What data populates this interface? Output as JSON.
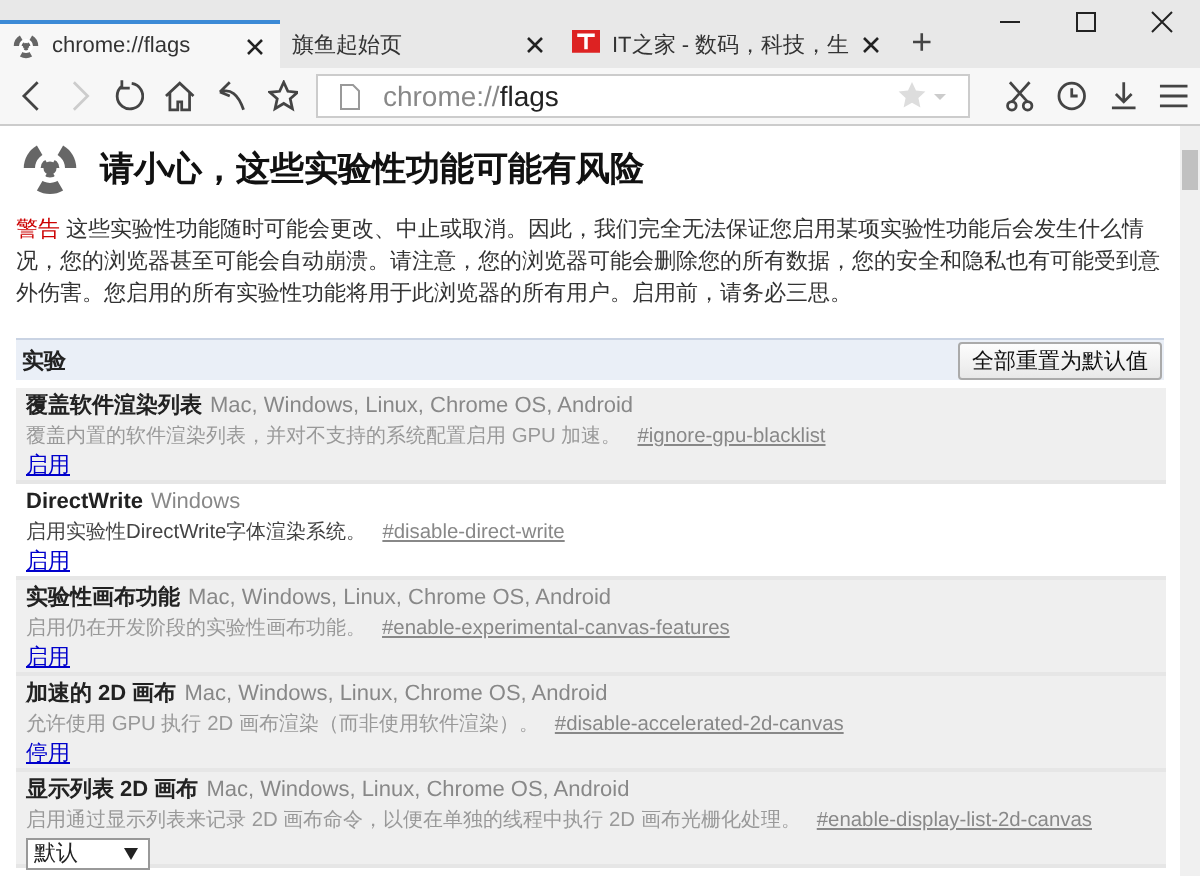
{
  "tabs": [
    {
      "title": "chrome://flags",
      "selected": true
    },
    {
      "title": "旗鱼起始页",
      "selected": false
    },
    {
      "title": "IT之家 - 数码，科技，生",
      "selected": false
    }
  ],
  "new_tab": "+",
  "address_bar": {
    "url_scheme": "chrome://",
    "url_path": "flags"
  },
  "page": {
    "heading": "请小心，这些实验性功能可能有风险",
    "warning_label": "警告",
    "warning_text": "这些实验性功能随时可能会更改、中止或取消。因此，我们完全无法保证您启用某项实验性功能后会发生什么情况，您的浏览器甚至可能会自动崩溃。请注意，您的浏览器可能会删除您的所有数据，您的安全和隐私也有可能受到意外伤害。您启用的所有实验性功能将用于此浏览器的所有用户。启用前，请务必三思。",
    "section_title": "实验",
    "reset_button": "全部重置为默认值"
  },
  "experiments": [
    {
      "name": "覆盖软件渲染列表",
      "platforms": "Mac, Windows, Linux, Chrome OS, Android",
      "description": "覆盖内置的软件渲染列表，并对不支持的系统配置启用 GPU 加速。",
      "anchor": "#ignore-gpu-blacklist",
      "dimmed": true,
      "action": {
        "kind": "link",
        "label": "启用"
      }
    },
    {
      "name": "DirectWrite",
      "platforms": "Windows",
      "description": "启用实验性DirectWrite字体渲染系统。",
      "anchor": "#disable-direct-write",
      "dimmed": false,
      "action": {
        "kind": "link",
        "label": "启用"
      }
    },
    {
      "name": "实验性画布功能",
      "platforms": "Mac, Windows, Linux, Chrome OS, Android",
      "description": "启用仍在开发阶段的实验性画布功能。",
      "anchor": "#enable-experimental-canvas-features",
      "dimmed": true,
      "action": {
        "kind": "link",
        "label": "启用"
      }
    },
    {
      "name": "加速的 2D 画布",
      "platforms": "Mac, Windows, Linux, Chrome OS, Android",
      "description": "允许使用 GPU 执行 2D 画布渲染（而非使用软件渲染）。",
      "anchor": "#disable-accelerated-2d-canvas",
      "dimmed": true,
      "action": {
        "kind": "link",
        "label": "停用"
      }
    },
    {
      "name": "显示列表 2D 画布",
      "platforms": "Mac, Windows, Linux, Chrome OS, Android",
      "description": "启用通过显示列表来记录 2D 画布命令，以便在单独的线程中执行 2D 画布光栅化处理。",
      "anchor": "#enable-display-list-2d-canvas",
      "dimmed": true,
      "action": {
        "kind": "select",
        "label": "默认"
      }
    }
  ]
}
